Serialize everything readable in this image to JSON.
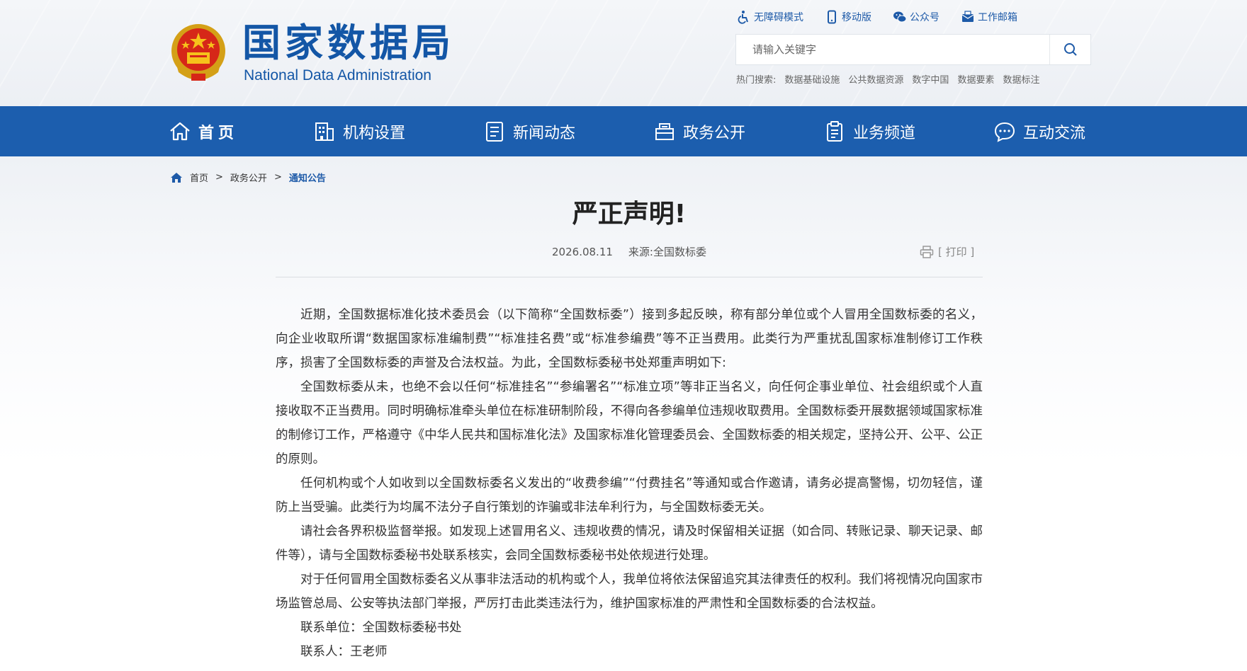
{
  "header": {
    "logo_cn": "国家数据局",
    "logo_en": "National Data Administration",
    "toplinks": [
      {
        "label": "无障碍模式",
        "icon": "accessibility-icon"
      },
      {
        "label": "移动版",
        "icon": "mobile-icon"
      },
      {
        "label": "公众号",
        "icon": "wechat-icon"
      },
      {
        "label": "工作邮箱",
        "icon": "mail-icon"
      }
    ],
    "search": {
      "placeholder": "请输入关键字"
    },
    "hot": {
      "label": "热门搜索:",
      "items": [
        "数据基础设施",
        "公共数据资源",
        "数字中国",
        "数据要素",
        "数据标注"
      ]
    }
  },
  "nav": {
    "items": [
      {
        "label": "首页",
        "icon": "home-icon"
      },
      {
        "label": "机构设置",
        "icon": "building-icon"
      },
      {
        "label": "新闻动态",
        "icon": "news-icon"
      },
      {
        "label": "政务公开",
        "icon": "folder-icon"
      },
      {
        "label": "业务频道",
        "icon": "clipboard-icon"
      },
      {
        "label": "互动交流",
        "icon": "chat-icon"
      }
    ]
  },
  "breadcrumb": [
    "首页",
    "政务公开",
    "通知公告"
  ],
  "article": {
    "title": "严正声明!",
    "date": "2026.08.11",
    "source": "来源:全国数标委",
    "print": "[ 打印 ]",
    "paragraphs": [
      "近期，全国数据标准化技术委员会（以下简称“全国数标委”）接到多起反映，称有部分单位或个人冒用全国数标委的名义，向企业收取所谓“数据国家标准编制费”“标准挂名费”或“标准参编费”等不正当费用。此类行为严重扰乱国家标准制修订工作秩序，损害了全国数标委的声誉及合法权益。为此，全国数标委秘书处郑重声明如下:",
      "全国数标委从未，也绝不会以任何“标准挂名”“参编署名”“标准立项”等非正当名义，向任何企事业单位、社会组织或个人直接收取不正当费用。同时明确标准牵头单位在标准研制阶段，不得向各参编单位违规收取费用。全国数标委开展数据领域国家标准的制修订工作，严格遵守《中华人民共和国标准化法》及国家标准化管理委员会、全国数标委的相关规定，坚持公开、公平、公正的原则。",
      "任何机构或个人如收到以全国数标委名义发出的“收费参编”“付费挂名”等通知或合作邀请，请务必提高警惕，切勿轻信，谨防上当受骗。此类行为均属不法分子自行策划的诈骗或非法牟利行为，与全国数标委无关。",
      "请社会各界积极监督举报。如发现上述冒用名义、违规收费的情况，请及时保留相关证据（如合同、转账记录、聊天记录、邮件等），请与全国数标委秘书处联系核实，会同全国数标委秘书处依规进行处理。",
      "对于任何冒用全国数标委名义从事非法活动的机构或个人，我单位将依法保留追究其法律责任的权利。我们将视情况向国家市场监管总局、公安等执法部门举报，严厉打击此类违法行为，维护国家标准的严肃性和全国数标委的合法权益。",
      "联系单位：全国数标委秘书处",
      "联系人：王老师"
    ]
  },
  "colors": {
    "brand": "#1c5eae",
    "logo": "#1356a6",
    "link": "#1d5aa8"
  }
}
